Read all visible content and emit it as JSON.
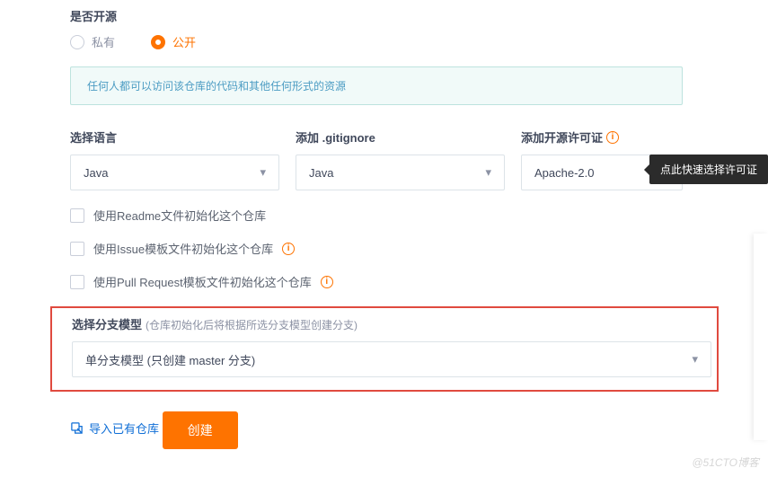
{
  "visibility": {
    "title": "是否开源",
    "options": [
      {
        "label": "私有",
        "selected": false
      },
      {
        "label": "公开",
        "selected": true
      }
    ]
  },
  "notice": "任何人都可以访问该仓库的代码和其他任何形式的资源",
  "fields": {
    "language": {
      "label": "选择语言",
      "value": "Java"
    },
    "gitignore": {
      "label": "添加 .gitignore",
      "value": "Java"
    },
    "license": {
      "label": "添加开源许可证",
      "value": "Apache-2.0"
    }
  },
  "tooltip": "点此快速选择许可证",
  "checks": {
    "readme": {
      "label": "使用Readme文件初始化这个仓库"
    },
    "issue": {
      "label": "使用Issue模板文件初始化这个仓库"
    },
    "pr": {
      "label": "使用Pull Request模板文件初始化这个仓库"
    }
  },
  "branch": {
    "label": "选择分支模型",
    "hint": "(仓库初始化后将根据所选分支模型创建分支)",
    "value": "单分支模型 (只创建 master 分支)"
  },
  "importLink": "导入已有仓库",
  "createBtn": "创建",
  "watermark": "@51CTO博客"
}
